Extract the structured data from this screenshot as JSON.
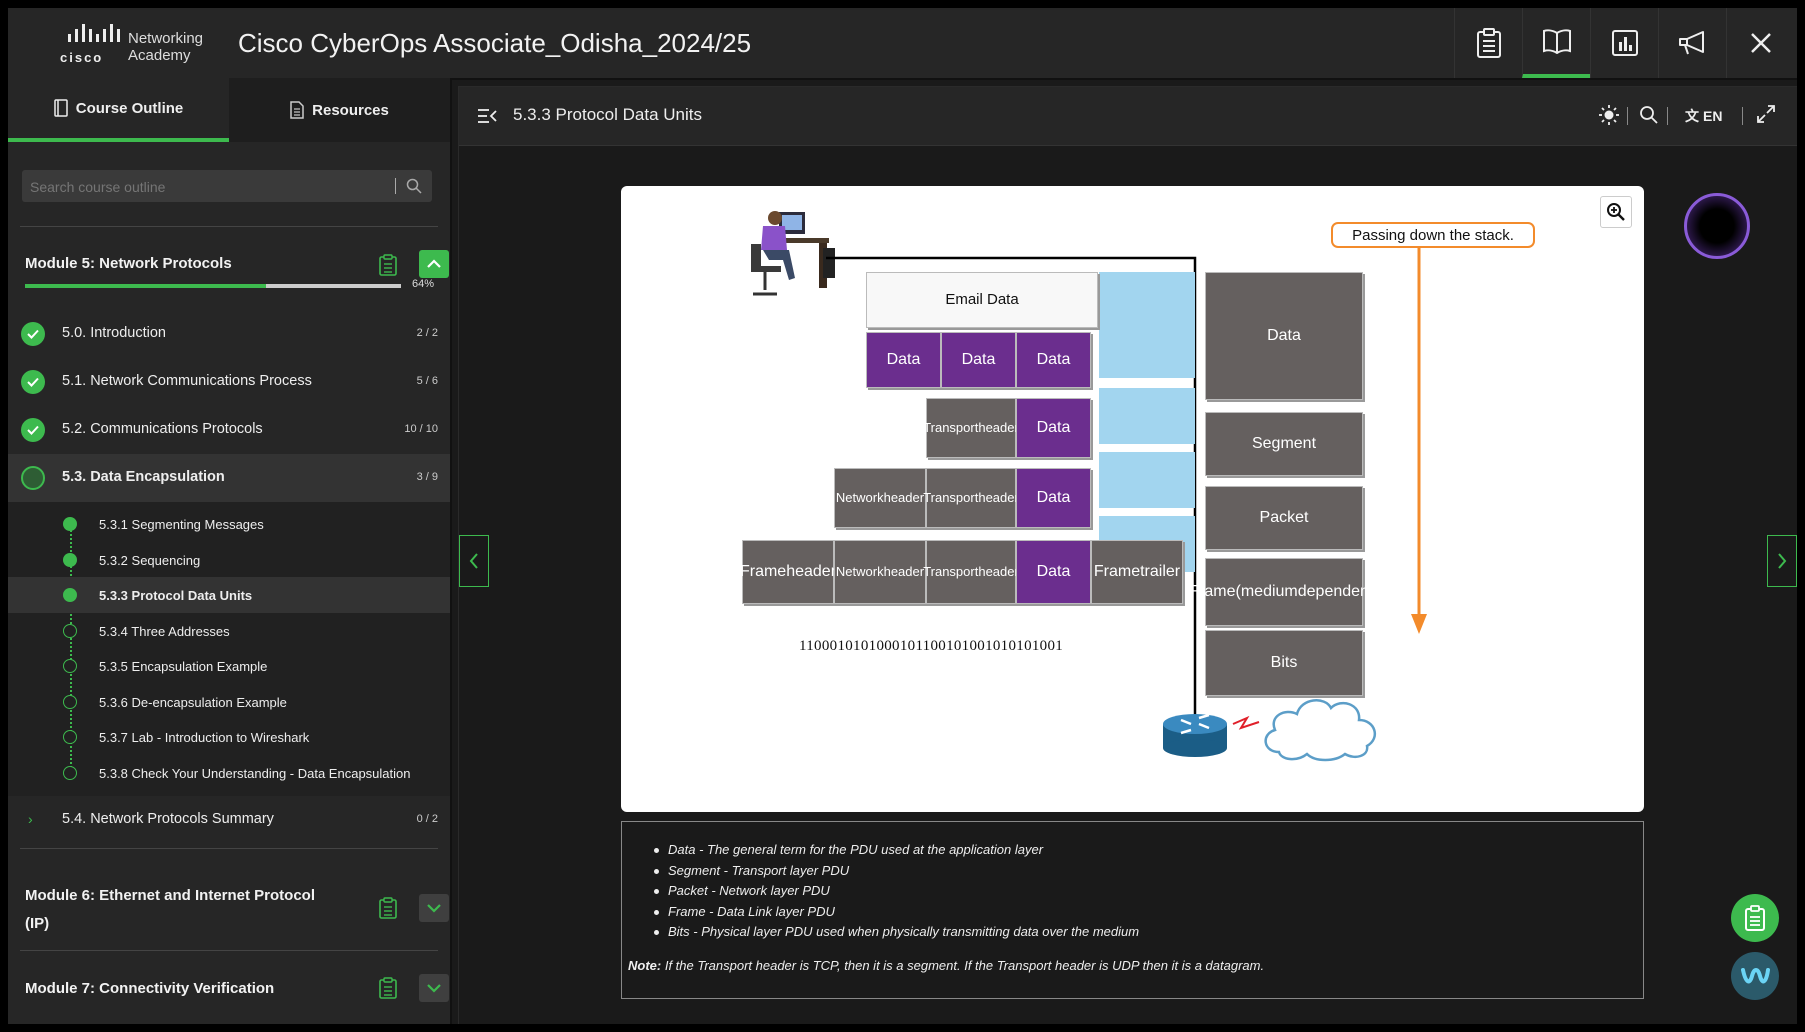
{
  "brand": {
    "logo_word": "cisco",
    "academy_line1": "Networking",
    "academy_line2": "Academy"
  },
  "app_title": "Cisco CyberOps Associate_Odisha_2024/25",
  "top_icons": [
    "clipboard-icon",
    "book-icon",
    "chart-icon",
    "megaphone-icon",
    "close-icon"
  ],
  "sidebar": {
    "tabs": [
      {
        "label": "Course Outline",
        "active": true
      },
      {
        "label": "Resources",
        "active": false
      }
    ],
    "search_placeholder": "Search course outline",
    "module5": {
      "title": "Module 5: Network Protocols",
      "progress_fraction": 0.64,
      "progress_label": "64%",
      "sections": [
        {
          "label": "5.0. Introduction",
          "count": "2 / 2",
          "state": "done"
        },
        {
          "label": "5.1. Network Communications Process",
          "count": "5 / 6",
          "state": "done"
        },
        {
          "label": "5.2. Communications Protocols",
          "count": "10 / 10",
          "state": "done"
        },
        {
          "label": "5.3. Data Encapsulation",
          "count": "3 / 9",
          "state": "current"
        }
      ],
      "subitems": [
        {
          "label": "5.3.1 Segmenting Messages",
          "state": "done"
        },
        {
          "label": "5.3.2 Sequencing",
          "state": "done"
        },
        {
          "label": "5.3.3 Protocol Data Units",
          "state": "current"
        },
        {
          "label": "5.3.4 Three Addresses",
          "state": "todo"
        },
        {
          "label": "5.3.5 Encapsulation Example",
          "state": "todo"
        },
        {
          "label": "5.3.6 De-encapsulation Example",
          "state": "todo"
        },
        {
          "label": "5.3.7 Lab - Introduction to Wireshark",
          "state": "todo"
        },
        {
          "label": "5.3.8 Check Your Understanding - Data Encapsulation",
          "state": "todo"
        }
      ],
      "summary": {
        "label": "5.4. Network Protocols Summary",
        "count": "0 / 2"
      }
    },
    "module6": {
      "title_line1": "Module 6: Ethernet and Internet Protocol",
      "title_line2": "(IP)"
    },
    "module7": {
      "title": "Module 7: Connectivity Verification"
    }
  },
  "main": {
    "breadcrumb": "5.3.3 Protocol Data Units",
    "language": "EN",
    "diagram": {
      "email_data": "Email Data",
      "data": "Data",
      "transport_header": [
        "Transport",
        "header"
      ],
      "network_header": [
        "Network",
        "header"
      ],
      "frame_header": [
        "Frame",
        "header"
      ],
      "frame_trailer": [
        "Frame",
        "trailer"
      ],
      "bits_string": "1100010101000101100101001010101001",
      "stack_label": "Passing down the stack.",
      "pdu_names": {
        "data": "Data",
        "segment": "Segment",
        "packet": "Packet",
        "frame": [
          "Frame",
          "(medium",
          "dependent)"
        ],
        "bits": "Bits"
      }
    },
    "notes": {
      "bullets": [
        "Data - The general term for the PDU used at the application layer",
        "Segment - Transport layer PDU",
        "Packet - Network layer PDU",
        "Frame - Data Link layer PDU",
        "Bits - Physical layer PDU used when physically transmitting data over the medium"
      ],
      "note_label": "Note:",
      "note_text": " If the Transport header is TCP, then it is a segment. If the Transport header is UDP then it is a datagram."
    }
  },
  "colors": {
    "accent": "#3dba4e",
    "pdu_gray": "#65605f",
    "pdu_purple": "#6b2e8e",
    "medium_blue": "#a2d5ef",
    "stack_orange": "#f38b2b"
  }
}
